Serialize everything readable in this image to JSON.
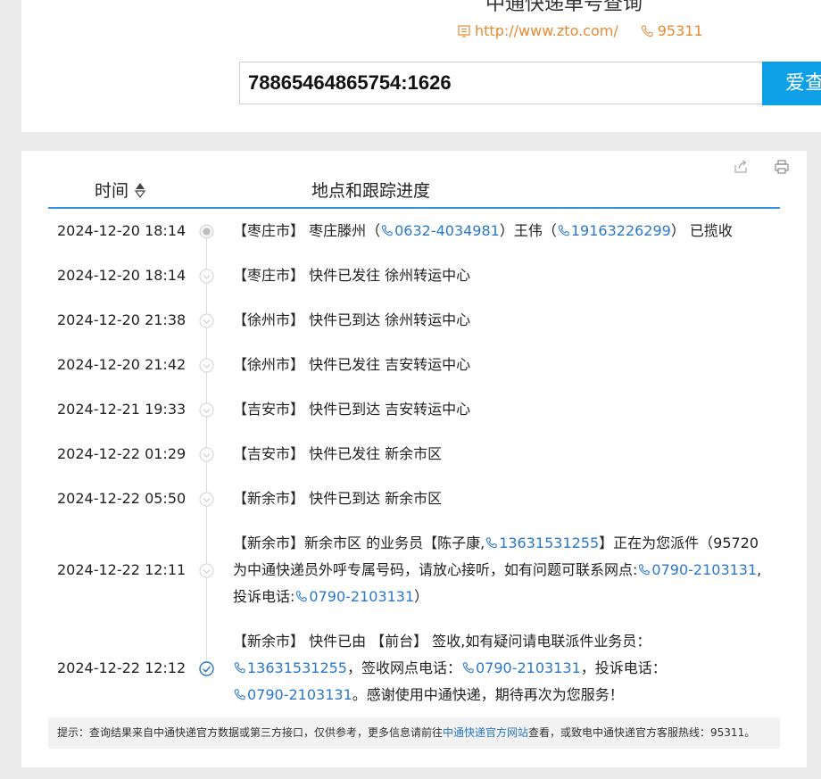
{
  "header": {
    "title_partial": "中通快递单号查询",
    "website": "http://www.zto.com/",
    "hotline": "95311"
  },
  "search": {
    "value": "78865464865754:1626",
    "button_label": "爱查"
  },
  "table": {
    "col_time": "时间",
    "col_location": "地点和跟踪进度"
  },
  "events": [
    {
      "time": "2024-12-20 18:14",
      "seg": [
        {
          "t": "【枣庄市】 枣庄滕州（"
        },
        {
          "p": "0632-4034981"
        },
        {
          "t": "）王伟（"
        },
        {
          "p": "19163226299"
        },
        {
          "t": "） 已揽收"
        }
      ]
    },
    {
      "time": "2024-12-20 18:14",
      "seg": [
        {
          "t": "【枣庄市】 快件已发往 徐州转运中心"
        }
      ]
    },
    {
      "time": "2024-12-20 21:38",
      "seg": [
        {
          "t": "【徐州市】 快件已到达 徐州转运中心"
        }
      ]
    },
    {
      "time": "2024-12-20 21:42",
      "seg": [
        {
          "t": "【徐州市】 快件已发往 吉安转运中心"
        }
      ]
    },
    {
      "time": "2024-12-21 19:33",
      "seg": [
        {
          "t": "【吉安市】 快件已到达 吉安转运中心"
        }
      ]
    },
    {
      "time": "2024-12-22 01:29",
      "seg": [
        {
          "t": "【吉安市】 快件已发往 新余市区"
        }
      ]
    },
    {
      "time": "2024-12-22 05:50",
      "seg": [
        {
          "t": "【新余市】 快件已到达 新余市区"
        }
      ]
    },
    {
      "time": "2024-12-22 12:11",
      "seg": [
        {
          "t": "【新余市】新余市区 的业务员【陈子康,"
        },
        {
          "p": "13631531255"
        },
        {
          "t": "】正在为您派件（95720为中通快递员外呼专属号码，请放心接听，如有问题可联系网点:"
        },
        {
          "p": "0790-2103131"
        },
        {
          "t": ",投诉电话:"
        },
        {
          "p": "0790-2103131"
        },
        {
          "t": "）"
        }
      ]
    },
    {
      "time": "2024-12-22 12:12",
      "seg": [
        {
          "t": "【新余市】 快件已由 【前台】 签收,如有疑问请电联派件业务员："
        },
        {
          "p": "13631531255"
        },
        {
          "t": "，签收网点电话："
        },
        {
          "p": "0790-2103131"
        },
        {
          "t": "，投诉电话："
        },
        {
          "p": "0790-2103131"
        },
        {
          "t": "。感谢使用中通快递，期待再次为您服务！"
        }
      ]
    }
  ],
  "tip": {
    "prefix": "提示：查询结果来自中通快递官方数据或第三方接口，仅供参考，更多信息请前往",
    "link": "中通快递官方网站",
    "suffix": "查看，或致电中通快递官方客服热线：95311。"
  },
  "colors": {
    "accent": "#0ea0e6",
    "link": "#2a78c7",
    "header_line": "#3b8ed8",
    "contact": "#e8892f"
  },
  "icons": [
    "website-icon",
    "phone-icon",
    "share-icon",
    "print-icon",
    "sort-icon",
    "timeline-dot-icon",
    "check-circle-icon",
    "signed-icon"
  ]
}
